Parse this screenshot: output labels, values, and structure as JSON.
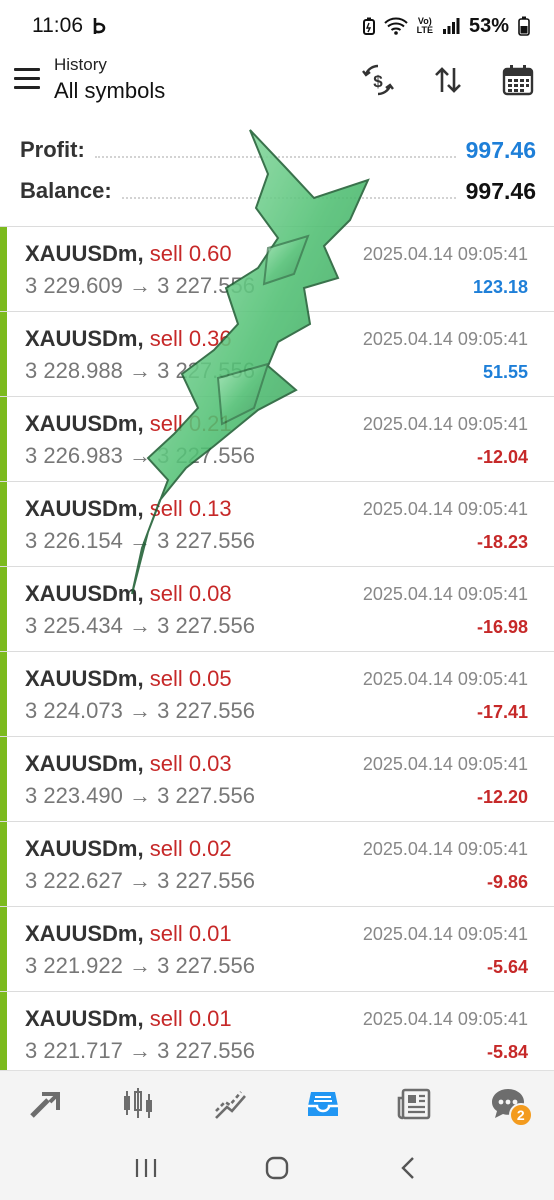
{
  "status_bar": {
    "time": "11:06",
    "lte_top": "Vo)",
    "lte_bottom": "LTE",
    "battery": "53%"
  },
  "header": {
    "subtitle": "History",
    "title": "All symbols"
  },
  "summary": {
    "profit_label": "Profit:",
    "profit_value": "997.46",
    "balance_label": "Balance:",
    "balance_value": "997.46"
  },
  "trades": [
    {
      "symbol": "XAUUSDm",
      "side": "sell 0.60",
      "prices": "3 229.609 → 3 227.556",
      "time": "2025.04.14 09:05:41",
      "pnl": "123.18",
      "positive": true
    },
    {
      "symbol": "XAUUSDm",
      "side": "sell 0.36",
      "prices": "3 228.988 → 3 227.556",
      "time": "2025.04.14 09:05:41",
      "pnl": "51.55",
      "positive": true
    },
    {
      "symbol": "XAUUSDm",
      "side": "sell 0.21",
      "prices": "3 226.983 → 3 227.556",
      "time": "2025.04.14 09:05:41",
      "pnl": "-12.04",
      "positive": false
    },
    {
      "symbol": "XAUUSDm",
      "side": "sell 0.13",
      "prices": "3 226.154 → 3 227.556",
      "time": "2025.04.14 09:05:41",
      "pnl": "-18.23",
      "positive": false
    },
    {
      "symbol": "XAUUSDm",
      "side": "sell 0.08",
      "prices": "3 225.434 → 3 227.556",
      "time": "2025.04.14 09:05:41",
      "pnl": "-16.98",
      "positive": false
    },
    {
      "symbol": "XAUUSDm",
      "side": "sell 0.05",
      "prices": "3 224.073 → 3 227.556",
      "time": "2025.04.14 09:05:41",
      "pnl": "-17.41",
      "positive": false
    },
    {
      "symbol": "XAUUSDm",
      "side": "sell 0.03",
      "prices": "3 223.490 → 3 227.556",
      "time": "2025.04.14 09:05:41",
      "pnl": "-12.20",
      "positive": false
    },
    {
      "symbol": "XAUUSDm",
      "side": "sell 0.02",
      "prices": "3 222.627 → 3 227.556",
      "time": "2025.04.14 09:05:41",
      "pnl": "-9.86",
      "positive": false
    },
    {
      "symbol": "XAUUSDm",
      "side": "sell 0.01",
      "prices": "3 221.922 → 3 227.556",
      "time": "2025.04.14 09:05:41",
      "pnl": "-5.64",
      "positive": false
    },
    {
      "symbol": "XAUUSDm",
      "side": "sell 0.01",
      "prices": "3 221.717 → 3 227.556",
      "time": "2025.04.14 09:05:41",
      "pnl": "-5.84",
      "positive": false
    }
  ],
  "bottom_nav": {
    "chat_badge": "2"
  },
  "icons": {
    "menu": "menu-icon",
    "dollar_exchange": "dollar-exchange-icon",
    "sort": "sort-icon",
    "calendar": "calendar-icon",
    "quotes": "quotes-icon",
    "chart": "chart-icon",
    "trade": "trade-icon",
    "history": "history-icon",
    "news": "news-icon",
    "chat": "chat-icon"
  },
  "colors": {
    "accent_green": "#7cba1e",
    "profit_blue": "#1e7fd8",
    "loss_red": "#c62828",
    "active_tab": "#2196f3"
  }
}
